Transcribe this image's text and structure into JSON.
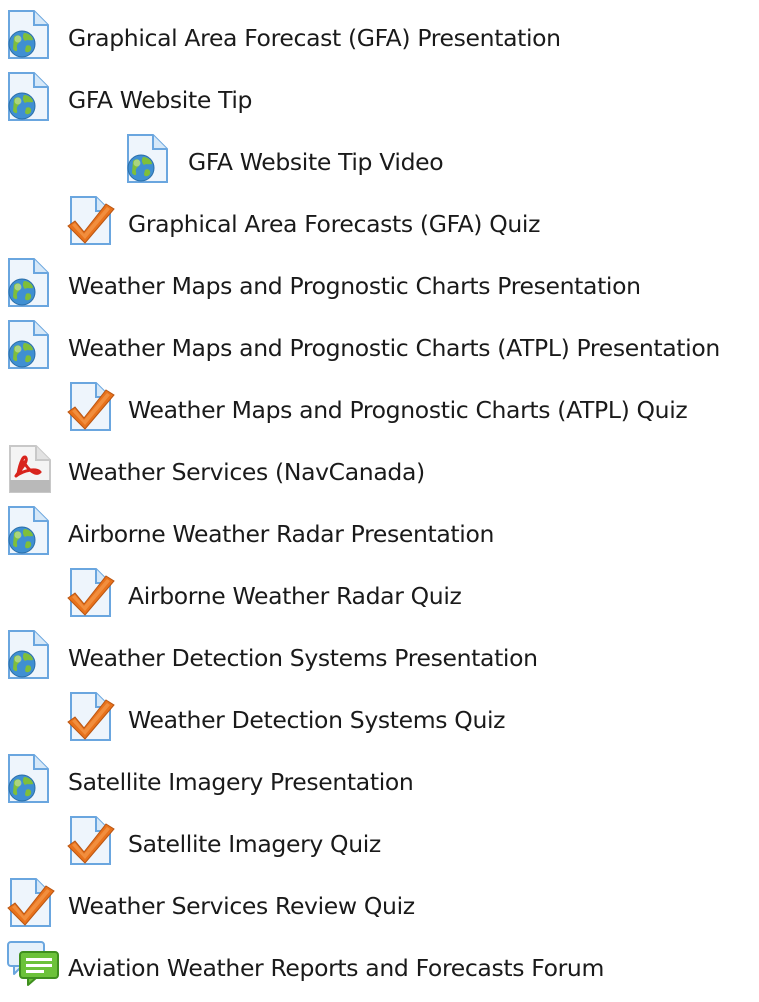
{
  "course_section": {
    "activities": [
      {
        "label": "Graphical Area Forecast (GFA) Presentation",
        "icon": "web-page-icon",
        "level": 0
      },
      {
        "label": "GFA Website Tip",
        "icon": "web-page-icon",
        "level": 0
      },
      {
        "label": "GFA Website Tip Video",
        "icon": "web-page-icon",
        "level": 2
      },
      {
        "label": "Graphical Area Forecasts (GFA) Quiz",
        "icon": "quiz-icon",
        "level": 1
      },
      {
        "label": "Weather Maps and Prognostic Charts Presentation",
        "icon": "web-page-icon",
        "level": 0
      },
      {
        "label": "Weather Maps and Prognostic Charts (ATPL) Presentation",
        "icon": "web-page-icon",
        "level": 0
      },
      {
        "label": "Weather Maps and Prognostic Charts (ATPL) Quiz",
        "icon": "quiz-icon",
        "level": 1
      },
      {
        "label": "Weather Services (NavCanada)",
        "icon": "pdf-icon",
        "level": 0
      },
      {
        "label": "Airborne Weather Radar Presentation",
        "icon": "web-page-icon",
        "level": 0
      },
      {
        "label": "Airborne Weather Radar Quiz",
        "icon": "quiz-icon",
        "level": 1
      },
      {
        "label": "Weather Detection Systems Presentation",
        "icon": "web-page-icon",
        "level": 0
      },
      {
        "label": "Weather Detection Systems Quiz",
        "icon": "quiz-icon",
        "level": 1
      },
      {
        "label": "Satellite Imagery Presentation",
        "icon": "web-page-icon",
        "level": 0
      },
      {
        "label": "Satellite Imagery Quiz",
        "icon": "quiz-icon",
        "level": 1
      },
      {
        "label": "Weather Services Review Quiz",
        "icon": "quiz-icon",
        "level": 0
      },
      {
        "label": "Aviation Weather Reports and Forecasts Forum",
        "icon": "forum-icon",
        "level": 0
      }
    ]
  },
  "colors": {
    "text": "#1a1a1a",
    "page_blue": "#5b9bd5",
    "check_orange": "#e8721c",
    "pdf_red": "#d8231c",
    "forum_green": "#6cc23a"
  }
}
